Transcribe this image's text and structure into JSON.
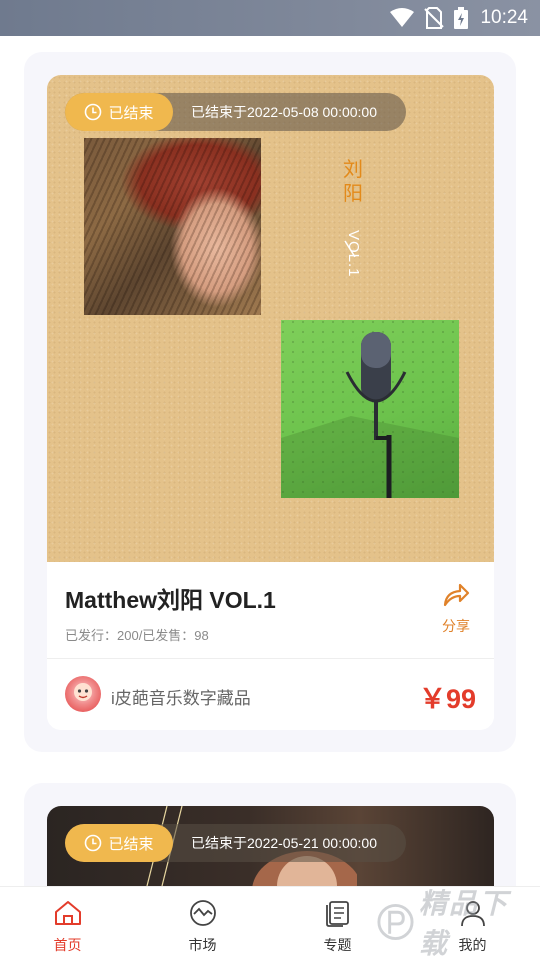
{
  "status_bar": {
    "time": "10:24"
  },
  "cards": [
    {
      "status_label": "已结束",
      "ended_text": "已结束于2022-05-08 00:00:00",
      "cover_vertical_title": "刘阳",
      "cover_vertical_sub": "VOL.1",
      "title": "Matthew刘阳 VOL.1",
      "issue_info": "已发行：200/已发售：98",
      "share_label": "分享",
      "publisher": "i皮葩音乐数字藏品",
      "price": "￥99"
    },
    {
      "status_label": "已结束",
      "ended_text": "已结束于2022-05-21 00:00:00"
    }
  ],
  "bottom_nav": {
    "active": "首页",
    "items": [
      {
        "label": "首页",
        "icon": "home-icon"
      },
      {
        "label": "市场",
        "icon": "market-icon"
      },
      {
        "label": "专题",
        "icon": "topic-icon"
      },
      {
        "label": "我的",
        "icon": "profile-icon"
      }
    ]
  },
  "watermark": "精品下载",
  "colors": {
    "accent": "#e33c2b",
    "pill": "#f0b84e",
    "share": "#e0822a"
  }
}
